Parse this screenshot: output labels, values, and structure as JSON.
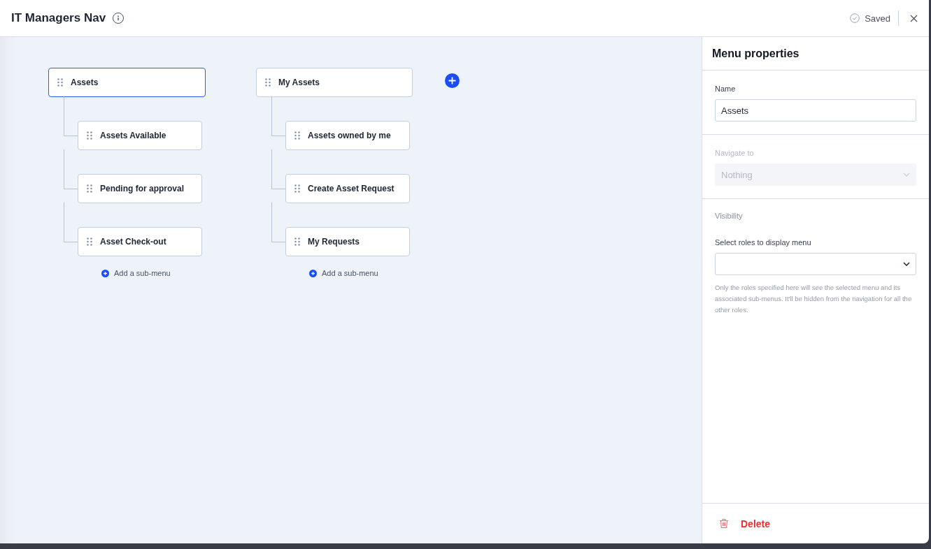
{
  "header": {
    "title": "IT Managers Nav",
    "status": "Saved"
  },
  "menus": [
    {
      "label": "Assets",
      "selected": true,
      "children": [
        {
          "label": "Assets Available"
        },
        {
          "label": "Pending for approval"
        },
        {
          "label": "Asset Check-out"
        }
      ],
      "add_label": "Add a sub-menu"
    },
    {
      "label": "My Assets",
      "selected": false,
      "children": [
        {
          "label": "Assets owned by me"
        },
        {
          "label": "Create Asset Request"
        },
        {
          "label": "My Requests"
        }
      ],
      "add_label": "Add a sub-menu"
    }
  ],
  "panel": {
    "title": "Menu properties",
    "name": {
      "label": "Name",
      "value": "Assets"
    },
    "navigate": {
      "label": "Navigate to",
      "value": "Nothing",
      "disabled": true
    },
    "visibility": {
      "heading": "Visibility",
      "label": "Select roles to display menu",
      "help": "Only the roles specified here will see the selected menu and its associated sub-menus. It'll be hidden from the navigation for all the other roles."
    },
    "delete_label": "Delete"
  }
}
